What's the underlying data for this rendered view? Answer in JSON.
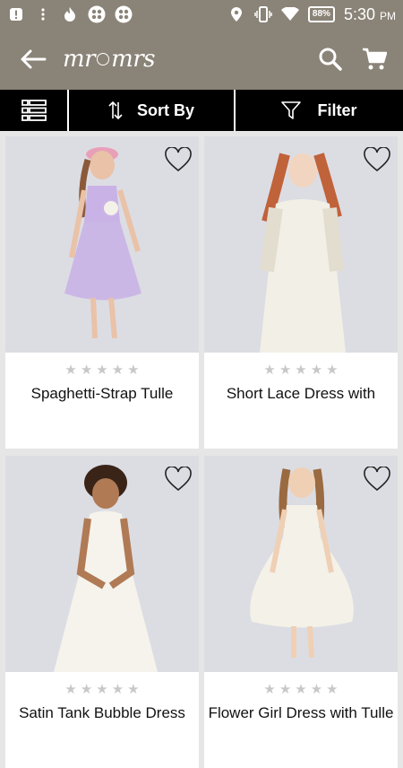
{
  "status": {
    "battery": "88%",
    "time": "5:30",
    "ampm": "PM"
  },
  "app": {
    "logo_left": "mr",
    "logo_right": "mrs"
  },
  "toolbar": {
    "sort_label": "Sort By",
    "filter_label": "Filter"
  },
  "products": [
    {
      "name": "Spaghetti-Strap Tulle",
      "rating": 0,
      "dress_color": "#c9b3e6"
    },
    {
      "name": "Short Lace Dress with",
      "rating": 0,
      "dress_color": "#f2efe6"
    },
    {
      "name": "Satin Tank Bubble Dress",
      "rating": 0,
      "dress_color": "#f5f3ec"
    },
    {
      "name": "Flower Girl Dress with Tulle",
      "rating": 0,
      "dress_color": "#f4f1e8"
    }
  ]
}
